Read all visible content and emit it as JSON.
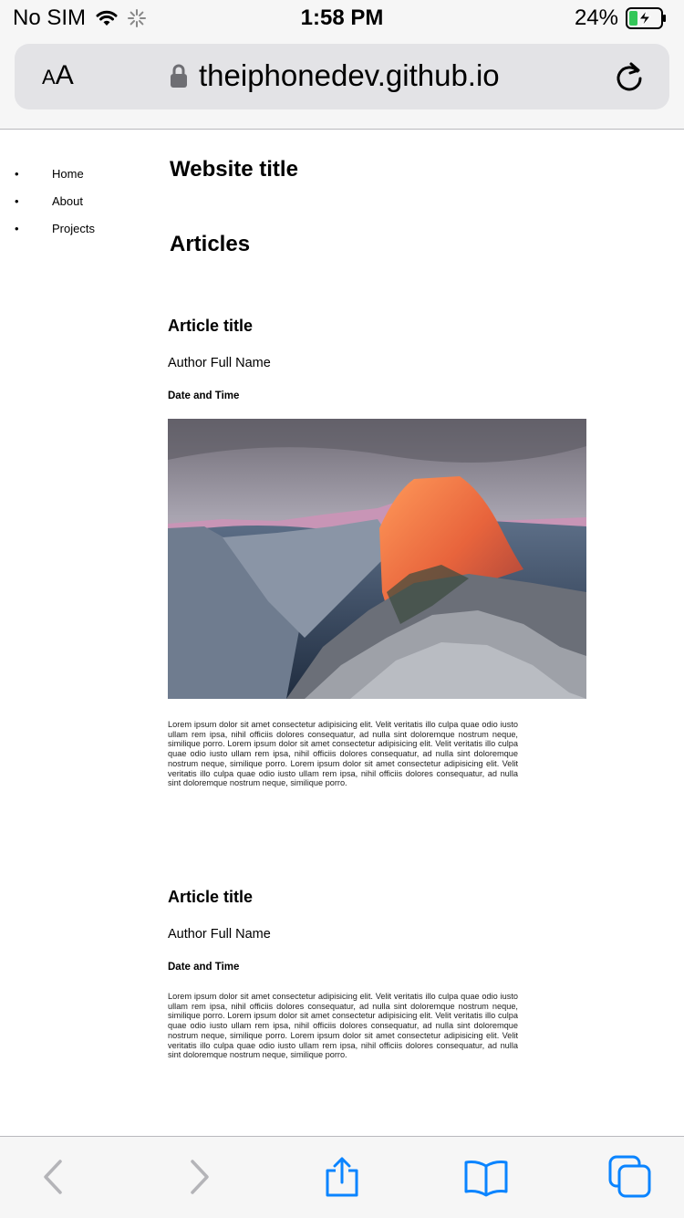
{
  "status_bar": {
    "carrier": "No SIM",
    "time": "1:58 PM",
    "battery": "24%"
  },
  "address_bar": {
    "text_size_label_small": "A",
    "text_size_label_large": "A",
    "url": "theiphonedev.github.io"
  },
  "nav": {
    "items": [
      "Home",
      "About",
      "Projects"
    ]
  },
  "page": {
    "site_title": "Website title",
    "section_title": "Articles"
  },
  "articles": [
    {
      "title": "Article title",
      "author": "Author Full Name",
      "date": "Date and Time",
      "body": "Lorem ipsum dolor sit amet consectetur adipisicing elit. Velit veritatis illo culpa quae odio iusto ullam rem ipsa, nihil officiis dolores consequatur, ad nulla sint doloremque nostrum neque, similique porro. Lorem ipsum dolor sit amet consectetur adipisicing elit. Velit veritatis illo culpa quae odio iusto ullam rem ipsa, nihil officiis dolores consequatur, ad nulla sint doloremque nostrum neque, similique porro. Lorem ipsum dolor sit amet consectetur adipisicing elit. Velit veritatis illo culpa quae odio iusto ullam rem ipsa, nihil officiis dolores consequatur, ad nulla sint doloremque nostrum neque, similique porro."
    },
    {
      "title": "Article title",
      "author": "Author Full Name",
      "date": "Date and Time",
      "body": "Lorem ipsum dolor sit amet consectetur adipisicing elit. Velit veritatis illo culpa quae odio iusto ullam rem ipsa, nihil officiis dolores consequatur, ad nulla sint doloremque nostrum neque, similique porro. Lorem ipsum dolor sit amet consectetur adipisicing elit. Velit veritatis illo culpa quae odio iusto ullam rem ipsa, nihil officiis dolores consequatur, ad nulla sint doloremque nostrum neque, similique porro. Lorem ipsum dolor sit amet consectetur adipisicing elit. Velit veritatis illo culpa quae odio iusto ullam rem ipsa, nihil officiis dolores consequatur, ad nulla sint doloremque nostrum neque, similique porro."
    }
  ],
  "toolbar": {
    "icons": [
      "back-icon",
      "forward-icon",
      "share-icon",
      "bookmarks-icon",
      "tabs-icon"
    ]
  },
  "colors": {
    "accent": "#0a84ff",
    "disabled": "#b4b4b8",
    "battery_charge": "#34c759"
  }
}
